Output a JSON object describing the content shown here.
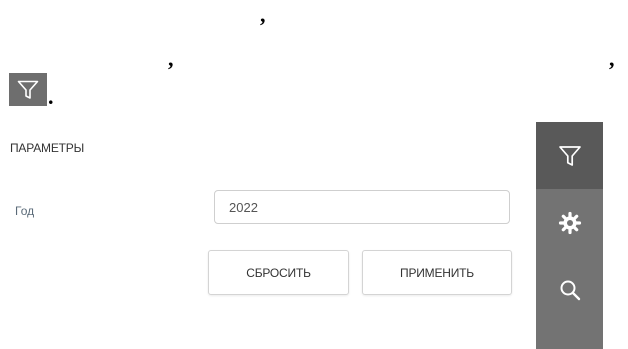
{
  "document": {
    "line1": ",",
    "line2_a": ",",
    "line2_b": ",",
    "line3": "."
  },
  "panel": {
    "title": "ПАРАМЕТРЫ",
    "year_label": "Год",
    "year_value": "2022",
    "reset_label": "СБРОСИТЬ",
    "apply_label": "ПРИМЕНИТЬ"
  },
  "toolbar": {
    "items": [
      {
        "icon": "filter-icon",
        "active": true
      },
      {
        "icon": "gear-icon",
        "active": false
      },
      {
        "icon": "search-icon",
        "active": false
      }
    ]
  },
  "colors": {
    "toolbar_bg": "#737373",
    "toolbar_active": "#595959",
    "icon": "#ffffff"
  }
}
